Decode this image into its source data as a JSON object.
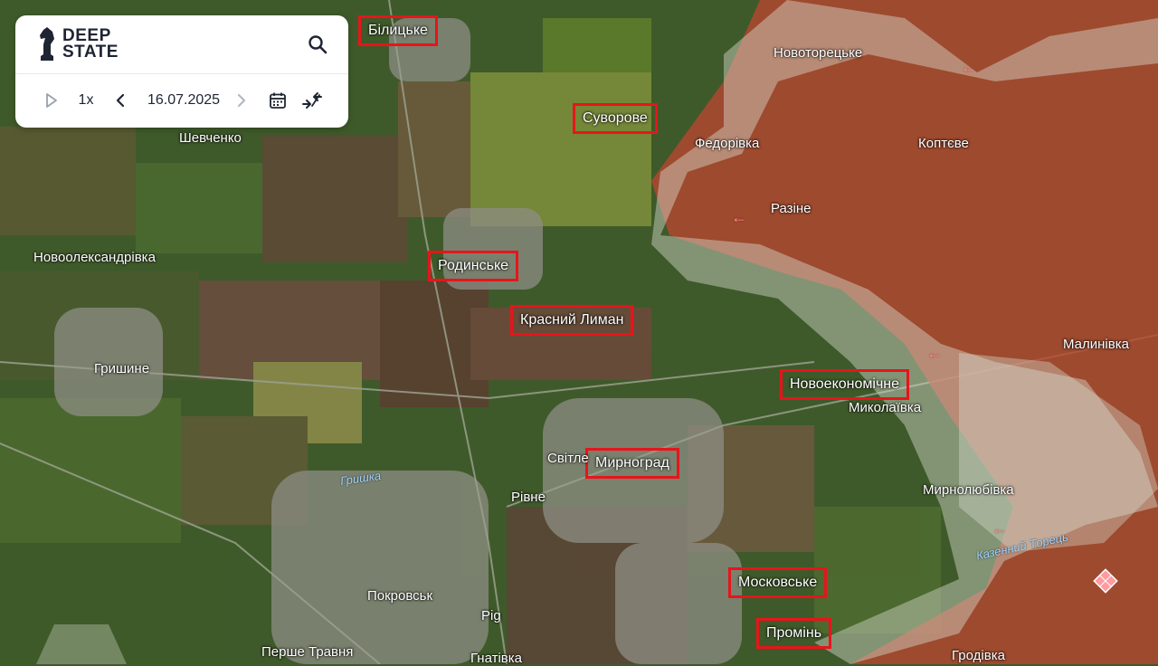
{
  "app": {
    "logo": {
      "line1": "DEEP",
      "line2": "STATE"
    }
  },
  "controls": {
    "play_icon": "play-icon",
    "speed": "1x",
    "prev_icon": "chevron-left-icon",
    "date": "16.07.2025",
    "next_icon": "chevron-right-icon",
    "calendar_icon": "calendar-icon",
    "compare_icon": "compare-icon",
    "search_icon": "search-icon"
  },
  "highlighted_places": [
    "Білицьке",
    "Суворове",
    "Родинське",
    "Красний Лиман",
    "Новоекономічне",
    "Мирноград",
    "Московське",
    "Промінь"
  ],
  "places": [
    "Новоторецьке",
    "Федорівка",
    "Коптєве",
    "Разіне",
    "Шевченко",
    "Новоолександрівка",
    "Гришине",
    "Малинівка",
    "Миколаївка",
    "Світле",
    "Рівне",
    "Мирнолюбівка",
    "Покровськ",
    "Перше Травня",
    "Гнатівка",
    "Гродівка",
    "Рig"
  ],
  "rivers": [
    "Гришка",
    "Казенний Торець"
  ],
  "colors": {
    "occupied": "#b8452f",
    "grey_zone": "#d8dccf",
    "highlight_box": "#e8141b",
    "arrow": "#ff8a8a"
  }
}
